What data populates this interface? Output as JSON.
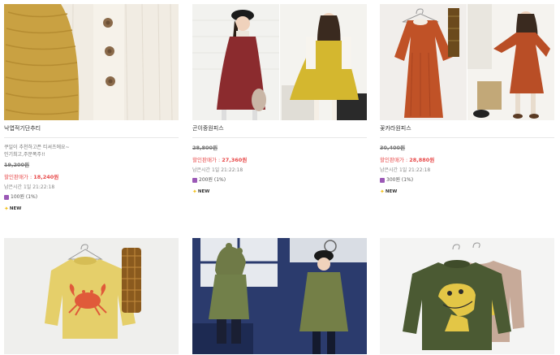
{
  "products": [
    {
      "name": "낙엽적기단추티",
      "description_lines": [
        "쿠일이 추천하고픈 티셔츠에요~",
        "인기최고,주문폭주!!"
      ],
      "original_price": "19,200원",
      "sale_label": "할인판매가 : ",
      "sale_price": "18,240원",
      "time_left": "남은시간 1일 21:22:18",
      "points": "100원 (1%)",
      "badge": "NEW",
      "image_icon": "mustard-knit-buttons-photo"
    },
    {
      "name": "곤이중원피스",
      "description_lines": [],
      "original_price": "28,800원",
      "sale_label": "할인판매가 : ",
      "sale_price": "27,360원",
      "time_left": "남은시간 1일 21:22:18",
      "points": "200원 (1%)",
      "badge": "NEW",
      "image_icon": "girl-dress-photo"
    },
    {
      "name": "꽃카라원피스",
      "description_lines": [],
      "original_price": "30,400원",
      "sale_label": "할인판매가 : ",
      "sale_price": "28,880원",
      "time_left": "남은시간 1일 21:22:18",
      "points": "300원 (1%)",
      "badge": "NEW",
      "image_icon": "orange-dress-photo"
    }
  ],
  "bottom_row": [
    {
      "image_icon": "crab-sweatshirt-photo"
    },
    {
      "image_icon": "green-hoodie-kids-photo"
    },
    {
      "image_icon": "dinosaur-sweatshirt-photo"
    }
  ],
  "colors": {
    "sale": "#e84b4b",
    "points_icon": "#9b59b6",
    "new_star": "#f3c11a"
  }
}
